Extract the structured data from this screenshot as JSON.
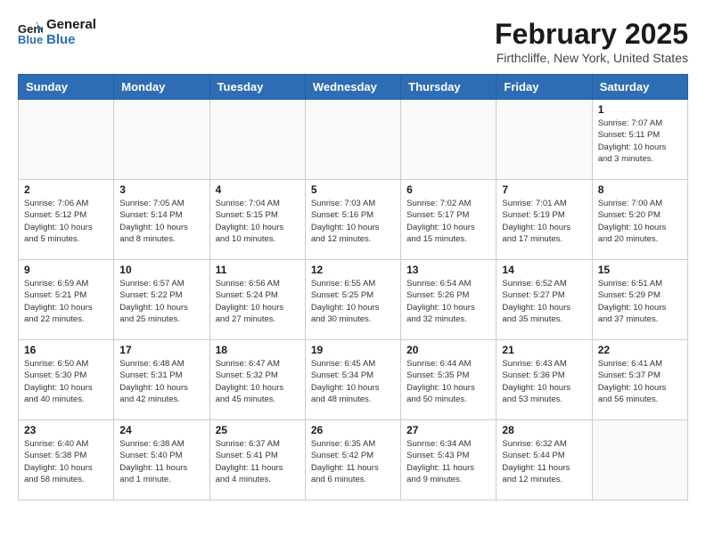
{
  "header": {
    "logo_line1": "General",
    "logo_line2": "Blue",
    "month_title": "February 2025",
    "location": "Firthcliffe, New York, United States"
  },
  "days_of_week": [
    "Sunday",
    "Monday",
    "Tuesday",
    "Wednesday",
    "Thursday",
    "Friday",
    "Saturday"
  ],
  "weeks": [
    [
      {
        "day": "",
        "info": ""
      },
      {
        "day": "",
        "info": ""
      },
      {
        "day": "",
        "info": ""
      },
      {
        "day": "",
        "info": ""
      },
      {
        "day": "",
        "info": ""
      },
      {
        "day": "",
        "info": ""
      },
      {
        "day": "1",
        "info": "Sunrise: 7:07 AM\nSunset: 5:11 PM\nDaylight: 10 hours\nand 3 minutes."
      }
    ],
    [
      {
        "day": "2",
        "info": "Sunrise: 7:06 AM\nSunset: 5:12 PM\nDaylight: 10 hours\nand 5 minutes."
      },
      {
        "day": "3",
        "info": "Sunrise: 7:05 AM\nSunset: 5:14 PM\nDaylight: 10 hours\nand 8 minutes."
      },
      {
        "day": "4",
        "info": "Sunrise: 7:04 AM\nSunset: 5:15 PM\nDaylight: 10 hours\nand 10 minutes."
      },
      {
        "day": "5",
        "info": "Sunrise: 7:03 AM\nSunset: 5:16 PM\nDaylight: 10 hours\nand 12 minutes."
      },
      {
        "day": "6",
        "info": "Sunrise: 7:02 AM\nSunset: 5:17 PM\nDaylight: 10 hours\nand 15 minutes."
      },
      {
        "day": "7",
        "info": "Sunrise: 7:01 AM\nSunset: 5:19 PM\nDaylight: 10 hours\nand 17 minutes."
      },
      {
        "day": "8",
        "info": "Sunrise: 7:00 AM\nSunset: 5:20 PM\nDaylight: 10 hours\nand 20 minutes."
      }
    ],
    [
      {
        "day": "9",
        "info": "Sunrise: 6:59 AM\nSunset: 5:21 PM\nDaylight: 10 hours\nand 22 minutes."
      },
      {
        "day": "10",
        "info": "Sunrise: 6:57 AM\nSunset: 5:22 PM\nDaylight: 10 hours\nand 25 minutes."
      },
      {
        "day": "11",
        "info": "Sunrise: 6:56 AM\nSunset: 5:24 PM\nDaylight: 10 hours\nand 27 minutes."
      },
      {
        "day": "12",
        "info": "Sunrise: 6:55 AM\nSunset: 5:25 PM\nDaylight: 10 hours\nand 30 minutes."
      },
      {
        "day": "13",
        "info": "Sunrise: 6:54 AM\nSunset: 5:26 PM\nDaylight: 10 hours\nand 32 minutes."
      },
      {
        "day": "14",
        "info": "Sunrise: 6:52 AM\nSunset: 5:27 PM\nDaylight: 10 hours\nand 35 minutes."
      },
      {
        "day": "15",
        "info": "Sunrise: 6:51 AM\nSunset: 5:29 PM\nDaylight: 10 hours\nand 37 minutes."
      }
    ],
    [
      {
        "day": "16",
        "info": "Sunrise: 6:50 AM\nSunset: 5:30 PM\nDaylight: 10 hours\nand 40 minutes."
      },
      {
        "day": "17",
        "info": "Sunrise: 6:48 AM\nSunset: 5:31 PM\nDaylight: 10 hours\nand 42 minutes."
      },
      {
        "day": "18",
        "info": "Sunrise: 6:47 AM\nSunset: 5:32 PM\nDaylight: 10 hours\nand 45 minutes."
      },
      {
        "day": "19",
        "info": "Sunrise: 6:45 AM\nSunset: 5:34 PM\nDaylight: 10 hours\nand 48 minutes."
      },
      {
        "day": "20",
        "info": "Sunrise: 6:44 AM\nSunset: 5:35 PM\nDaylight: 10 hours\nand 50 minutes."
      },
      {
        "day": "21",
        "info": "Sunrise: 6:43 AM\nSunset: 5:36 PM\nDaylight: 10 hours\nand 53 minutes."
      },
      {
        "day": "22",
        "info": "Sunrise: 6:41 AM\nSunset: 5:37 PM\nDaylight: 10 hours\nand 56 minutes."
      }
    ],
    [
      {
        "day": "23",
        "info": "Sunrise: 6:40 AM\nSunset: 5:38 PM\nDaylight: 10 hours\nand 58 minutes."
      },
      {
        "day": "24",
        "info": "Sunrise: 6:38 AM\nSunset: 5:40 PM\nDaylight: 11 hours\nand 1 minute."
      },
      {
        "day": "25",
        "info": "Sunrise: 6:37 AM\nSunset: 5:41 PM\nDaylight: 11 hours\nand 4 minutes."
      },
      {
        "day": "26",
        "info": "Sunrise: 6:35 AM\nSunset: 5:42 PM\nDaylight: 11 hours\nand 6 minutes."
      },
      {
        "day": "27",
        "info": "Sunrise: 6:34 AM\nSunset: 5:43 PM\nDaylight: 11 hours\nand 9 minutes."
      },
      {
        "day": "28",
        "info": "Sunrise: 6:32 AM\nSunset: 5:44 PM\nDaylight: 11 hours\nand 12 minutes."
      },
      {
        "day": "",
        "info": ""
      }
    ]
  ]
}
